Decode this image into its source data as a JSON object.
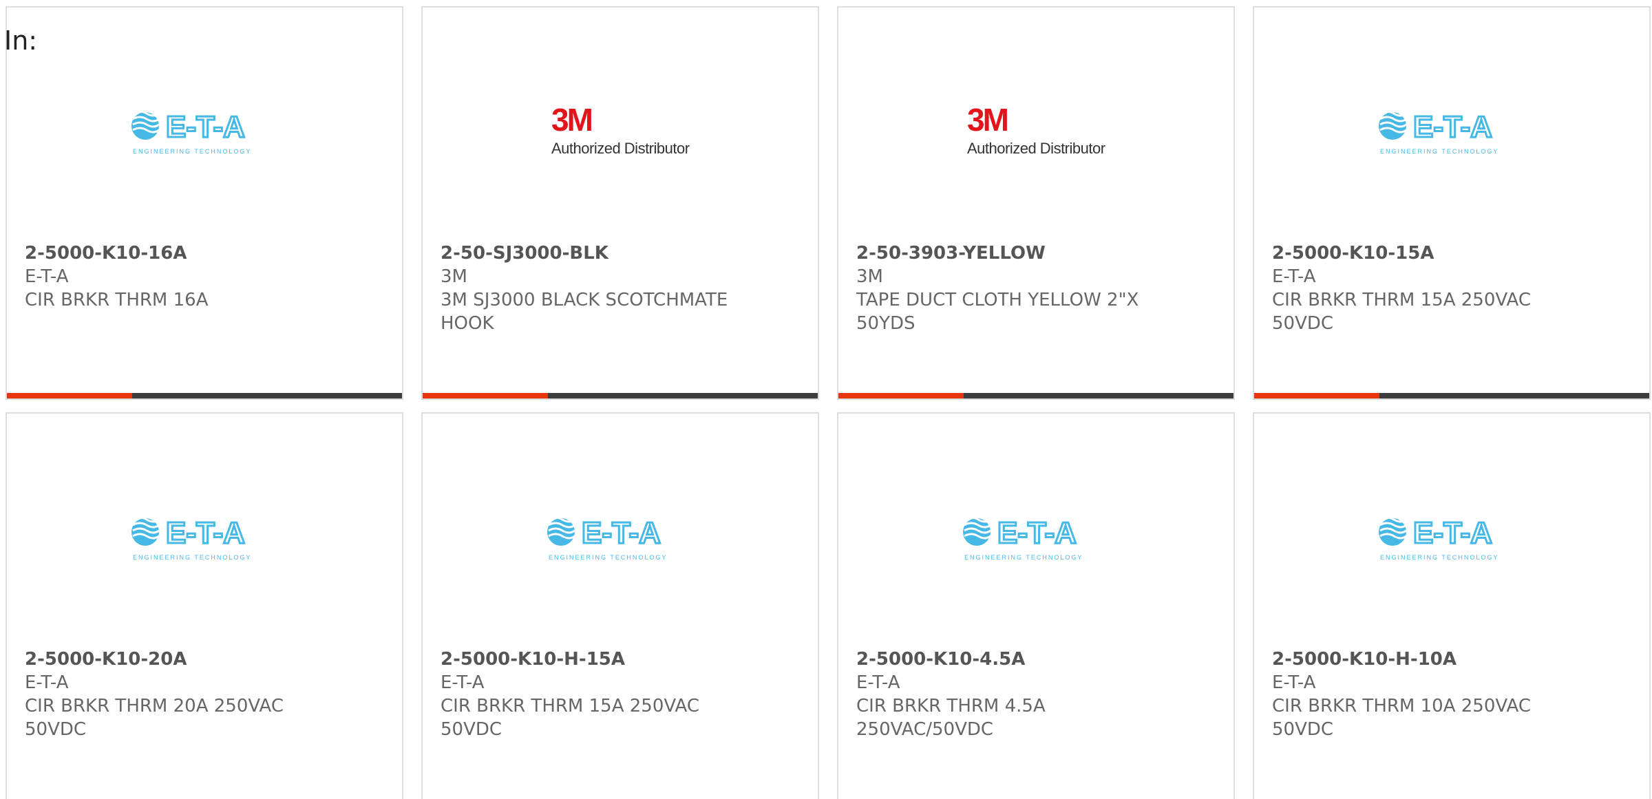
{
  "header": {
    "in_label": "In:"
  },
  "colors": {
    "accent": "#e8350e",
    "bar_dark": "#3d3d3d",
    "eta_blue": "#45b8e6",
    "brand_3m_red": "#e3151b"
  },
  "logos": {
    "eta": {
      "icon": "eta-logo",
      "wordmark": "E-T-A",
      "tagline": "ENGINEERING TECHNOLOGY"
    },
    "mmm": {
      "icon": "3m-logo",
      "wordmark": "3M",
      "tagline": "Authorized Distributor"
    }
  },
  "products": [
    {
      "part_number": "2-5000-K10-16A",
      "manufacturer": "E-T-A",
      "description": "CIR BRKR THRM 16A",
      "logo": "eta"
    },
    {
      "part_number": "2-50-SJ3000-BLK",
      "manufacturer": "3M",
      "description": "3M SJ3000 BLACK SCOTCHMATE HOOK",
      "logo": "mmm"
    },
    {
      "part_number": "2-50-3903-YELLOW",
      "manufacturer": "3M",
      "description": "TAPE DUCT CLOTH YELLOW 2\"X 50YDS",
      "logo": "mmm"
    },
    {
      "part_number": "2-5000-K10-15A",
      "manufacturer": "E-T-A",
      "description": "CIR BRKR THRM 15A 250VAC 50VDC",
      "logo": "eta"
    },
    {
      "part_number": "2-5000-K10-20A",
      "manufacturer": "E-T-A",
      "description": "CIR BRKR THRM 20A 250VAC 50VDC",
      "logo": "eta"
    },
    {
      "part_number": "2-5000-K10-H-15A",
      "manufacturer": "E-T-A",
      "description": "CIR BRKR THRM 15A 250VAC 50VDC",
      "logo": "eta"
    },
    {
      "part_number": "2-5000-K10-4.5A",
      "manufacturer": "E-T-A",
      "description": "CIR BRKR THRM 4.5A 250VAC/50VDC",
      "logo": "eta"
    },
    {
      "part_number": "2-5000-K10-H-10A",
      "manufacturer": "E-T-A",
      "description": "CIR BRKR THRM 10A 250VAC 50VDC",
      "logo": "eta"
    }
  ]
}
